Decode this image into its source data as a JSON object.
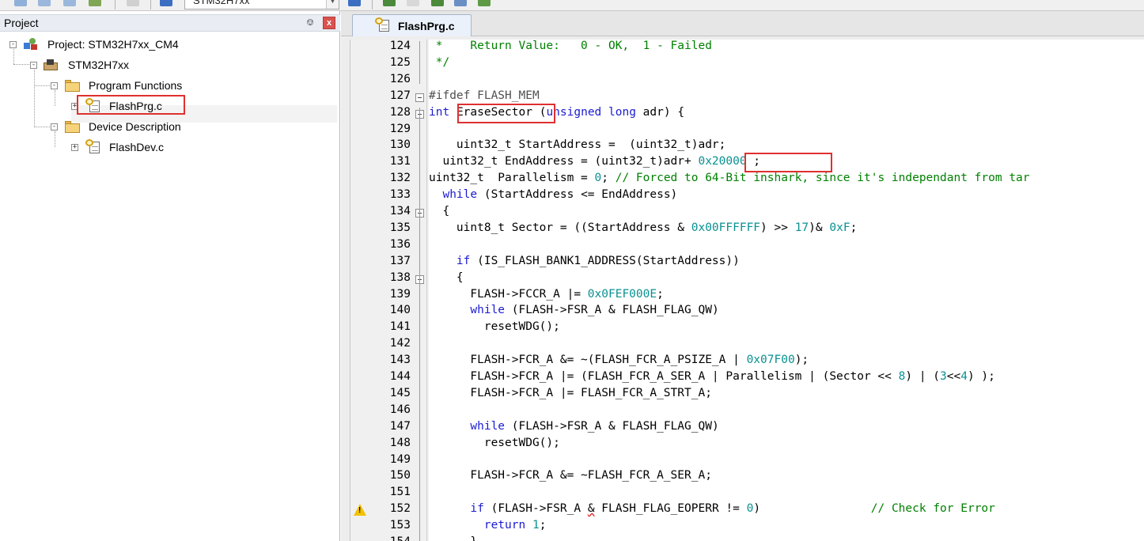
{
  "toolbar": {
    "target_selector_value": "STM32H7xx"
  },
  "project_pane": {
    "title": "Project",
    "pin_label": "ᵖ",
    "close_label": "x",
    "tree": {
      "project": "Project: STM32H7xx_CM4",
      "target": "STM32H7xx",
      "group_1": "Program Functions",
      "file_1": "FlashPrg.c",
      "group_2": "Device Description",
      "file_2": "FlashDev.c"
    }
  },
  "editor": {
    "active_tab": "FlashPrg.c",
    "highlight_color": "#e03030",
    "code_lines": [
      {
        "n": "124",
        "segs": [
          [
            "cm",
            " *    Return Value:   0 - OK,  1 - Failed"
          ]
        ]
      },
      {
        "n": "125",
        "segs": [
          [
            "cm",
            " */"
          ]
        ]
      },
      {
        "n": "126",
        "segs": []
      },
      {
        "n": "127",
        "segs": [
          [
            "pp",
            "#ifdef FLASH_MEM"
          ]
        ]
      },
      {
        "n": "128",
        "segs": [
          [
            "kw",
            "int"
          ],
          [
            "",
            " "
          ],
          [
            "",
            "EraseSector"
          ],
          [
            "",
            " ("
          ],
          [
            "kw",
            "unsigned long"
          ],
          [
            "",
            " adr) {"
          ]
        ]
      },
      {
        "n": "129",
        "segs": []
      },
      {
        "n": "130",
        "segs": [
          [
            "",
            "    uint32_t StartAddress =  (uint32_t)adr;"
          ]
        ]
      },
      {
        "n": "131",
        "segs": [
          [
            "",
            "  uint32_t EndAddress = (uint32_t)adr+ "
          ],
          [
            "num",
            "0x20000"
          ],
          [
            "",
            " ;"
          ]
        ]
      },
      {
        "n": "132",
        "segs": [
          [
            "",
            "uint32_t  Parallelism = "
          ],
          [
            "num",
            "0"
          ],
          [
            "",
            "; "
          ],
          [
            "cm",
            "// Forced to 64-Bit inshark, since it's independant from tar"
          ]
        ]
      },
      {
        "n": "133",
        "segs": [
          [
            "",
            "  "
          ],
          [
            "kw",
            "while"
          ],
          [
            "",
            " (StartAddress <= EndAddress)"
          ]
        ]
      },
      {
        "n": "134",
        "segs": [
          [
            "",
            "  {"
          ]
        ]
      },
      {
        "n": "135",
        "segs": [
          [
            "",
            "    uint8_t Sector = ((StartAddress & "
          ],
          [
            "num",
            "0x00FFFFFF"
          ],
          [
            "",
            ") >> "
          ],
          [
            "num",
            "17"
          ],
          [
            "",
            ")& "
          ],
          [
            "num",
            "0xF"
          ],
          [
            "",
            ";"
          ]
        ]
      },
      {
        "n": "136",
        "segs": []
      },
      {
        "n": "137",
        "segs": [
          [
            "",
            "    "
          ],
          [
            "kw",
            "if"
          ],
          [
            "",
            " (IS_FLASH_BANK1_ADDRESS(StartAddress))"
          ]
        ]
      },
      {
        "n": "138",
        "segs": [
          [
            "",
            "    {"
          ]
        ]
      },
      {
        "n": "139",
        "segs": [
          [
            "",
            "      FLASH->FCCR_A |= "
          ],
          [
            "num",
            "0x0FEF000E"
          ],
          [
            "",
            ";"
          ]
        ]
      },
      {
        "n": "140",
        "segs": [
          [
            "",
            "      "
          ],
          [
            "kw",
            "while"
          ],
          [
            "",
            " (FLASH->FSR_A & FLASH_FLAG_QW)"
          ]
        ]
      },
      {
        "n": "141",
        "segs": [
          [
            "",
            "        resetWDG();"
          ]
        ]
      },
      {
        "n": "142",
        "segs": []
      },
      {
        "n": "143",
        "segs": [
          [
            "",
            "      FLASH->FCR_A &= ~(FLASH_FCR_A_PSIZE_A | "
          ],
          [
            "num",
            "0x07F00"
          ],
          [
            "",
            ");"
          ]
        ]
      },
      {
        "n": "144",
        "segs": [
          [
            "",
            "      FLASH->FCR_A |= (FLASH_FCR_A_SER_A | Parallelism | (Sector << "
          ],
          [
            "num",
            "8"
          ],
          [
            "",
            ") | ("
          ],
          [
            "num",
            "3"
          ],
          [
            "",
            "<<"
          ],
          [
            "num",
            "4"
          ],
          [
            "",
            ") );"
          ]
        ]
      },
      {
        "n": "145",
        "segs": [
          [
            "",
            "      FLASH->FCR_A |= FLASH_FCR_A_STRT_A;"
          ]
        ]
      },
      {
        "n": "146",
        "segs": []
      },
      {
        "n": "147",
        "segs": [
          [
            "",
            "      "
          ],
          [
            "kw",
            "while"
          ],
          [
            "",
            " (FLASH->FSR_A & FLASH_FLAG_QW)"
          ]
        ]
      },
      {
        "n": "148",
        "segs": [
          [
            "",
            "        resetWDG();"
          ]
        ]
      },
      {
        "n": "149",
        "segs": []
      },
      {
        "n": "150",
        "segs": [
          [
            "",
            "      FLASH->FCR_A &= ~FLASH_FCR_A_SER_A;"
          ]
        ]
      },
      {
        "n": "151",
        "segs": []
      },
      {
        "n": "152",
        "segs": [
          [
            "",
            "      "
          ],
          [
            "kw",
            "if"
          ],
          [
            "",
            " (FLASH->FSR_A "
          ],
          [
            "squig",
            "&"
          ],
          [
            "",
            " FLASH_FLAG_EOPERR != "
          ],
          [
            "num",
            "0"
          ],
          [
            "",
            ")                "
          ],
          [
            "cm",
            "// Check for Error"
          ]
        ]
      },
      {
        "n": "153",
        "segs": [
          [
            "",
            "        "
          ],
          [
            "kw",
            "return"
          ],
          [
            "",
            " "
          ],
          [
            "num",
            "1"
          ],
          [
            "",
            ";"
          ]
        ]
      },
      {
        "n": "154",
        "segs": [
          [
            "",
            "      }"
          ]
        ]
      }
    ]
  }
}
